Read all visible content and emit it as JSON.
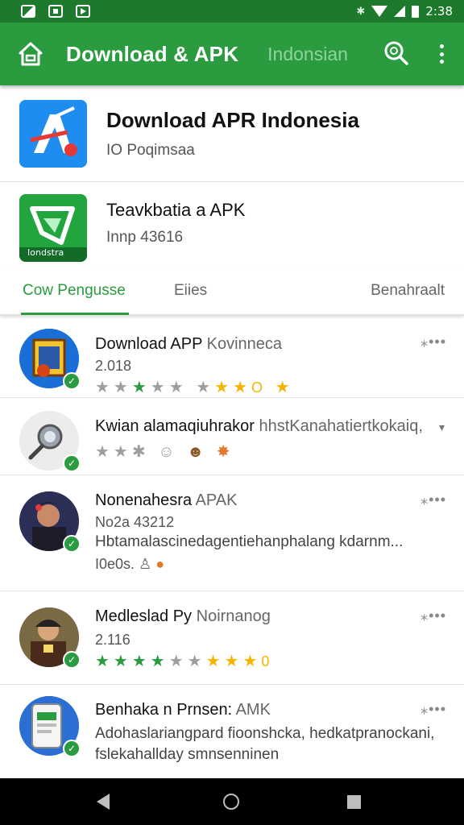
{
  "status_bar": {
    "time": "2:38",
    "icons": [
      "image-icon",
      "download-icon",
      "play-icon",
      "bluetooth-icon",
      "wifi-icon",
      "signal-icon",
      "battery-icon"
    ]
  },
  "app_bar": {
    "title": "Download & APK",
    "subtitle": "Indonsian",
    "bg_color": "#2a9b3e"
  },
  "featured": [
    {
      "title": "Download APR Indonesia",
      "subtitle": "IO Poqimsaa"
    },
    {
      "title": "Teavkbatia a APK",
      "subtitle": "Innp 43616",
      "icon_text": "Iondstra"
    }
  ],
  "tabs": {
    "items": [
      "Cow Pengusse",
      "Eiies",
      "Benahraalt"
    ],
    "active": 0
  },
  "list": [
    {
      "title": "Download APP",
      "title_muted": "Kovinneca",
      "line": "2.018",
      "menu": "⁎•••"
    },
    {
      "title": "Kwian alamaqiuhrakor",
      "title_muted": "hhstKanahatiertkokaiq,",
      "menu": "▾"
    },
    {
      "title": "Nonenahesra",
      "title_muted": "APAK",
      "line": "No2a 43212",
      "desc": "Hbtamalascinedagentiehanphalang kdarnm...",
      "meta": "I0e0s.",
      "menu": "⁎•••"
    },
    {
      "title": "Medleslad Py",
      "title_muted": "Noirnanog",
      "line": "2.116",
      "menu": "⁎•••"
    },
    {
      "title": "Benhaka n Prnsen:",
      "title_muted": "AMK",
      "desc": "Adohaslariangpard fioonshcka, hedkatpranockani,",
      "desc2": "fslekahallday smnsenninen",
      "menu": "⁎•••"
    }
  ],
  "nav": {
    "back": "back-icon",
    "home": "home-icon",
    "recents": "recents-icon"
  }
}
